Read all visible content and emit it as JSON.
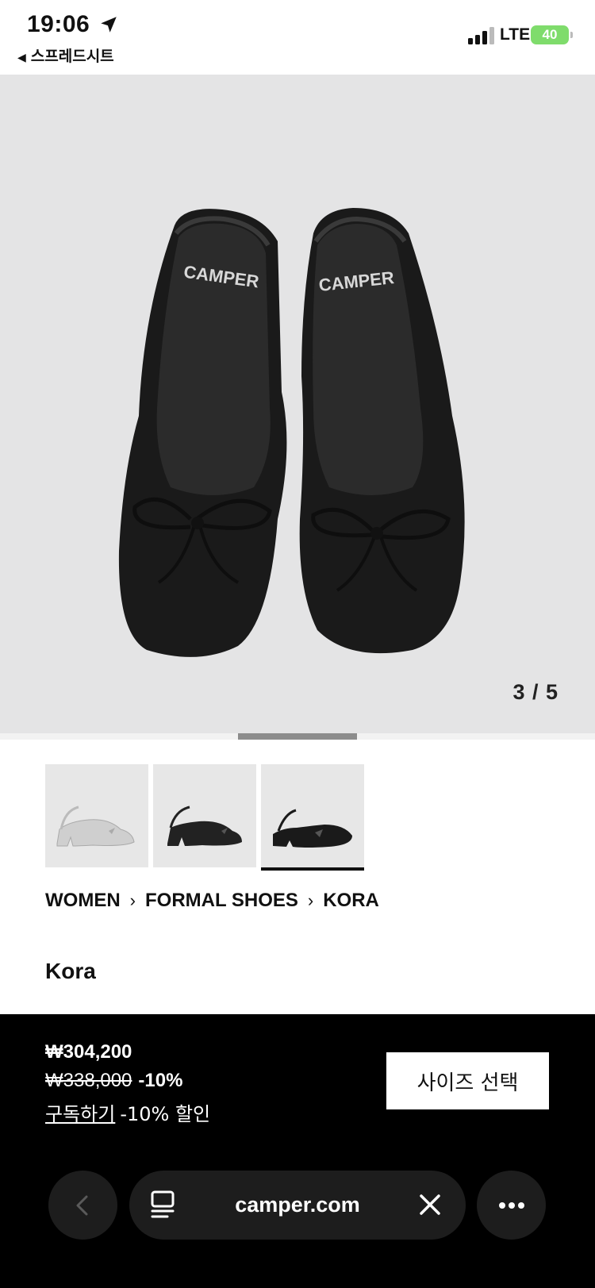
{
  "status_bar": {
    "time": "19:06",
    "back_app": "스프레드시트",
    "network": "LTE",
    "battery": "40"
  },
  "gallery": {
    "counter": "3 / 5",
    "current": 3,
    "total": 5,
    "thumbnails": [
      {
        "icon": "white-slingback-shoe",
        "active": false
      },
      {
        "icon": "black-slingback-shoe",
        "active": false
      },
      {
        "icon": "black-slingback-shoe-angle",
        "active": true
      }
    ],
    "logo_text": "CAMPER"
  },
  "breadcrumb": {
    "items": [
      "WOMEN",
      "FORMAL SHOES",
      "KORA"
    ],
    "separator": "›"
  },
  "product": {
    "title": "Kora"
  },
  "price": {
    "current": "₩304,200",
    "original": "₩338,000",
    "discount": "-10%",
    "subscribe_link": "구독하기",
    "subscribe_text": "-10% 할인",
    "size_button": "사이즈 선택"
  },
  "browser": {
    "url": "camper.com",
    "icons": [
      "chevron-left-icon",
      "tabs-icon",
      "close-icon",
      "more-icon"
    ]
  },
  "colors": {
    "hero_bg": "#e4e4e5",
    "price_bar": "#000000",
    "battery": "#7fdc6c"
  }
}
